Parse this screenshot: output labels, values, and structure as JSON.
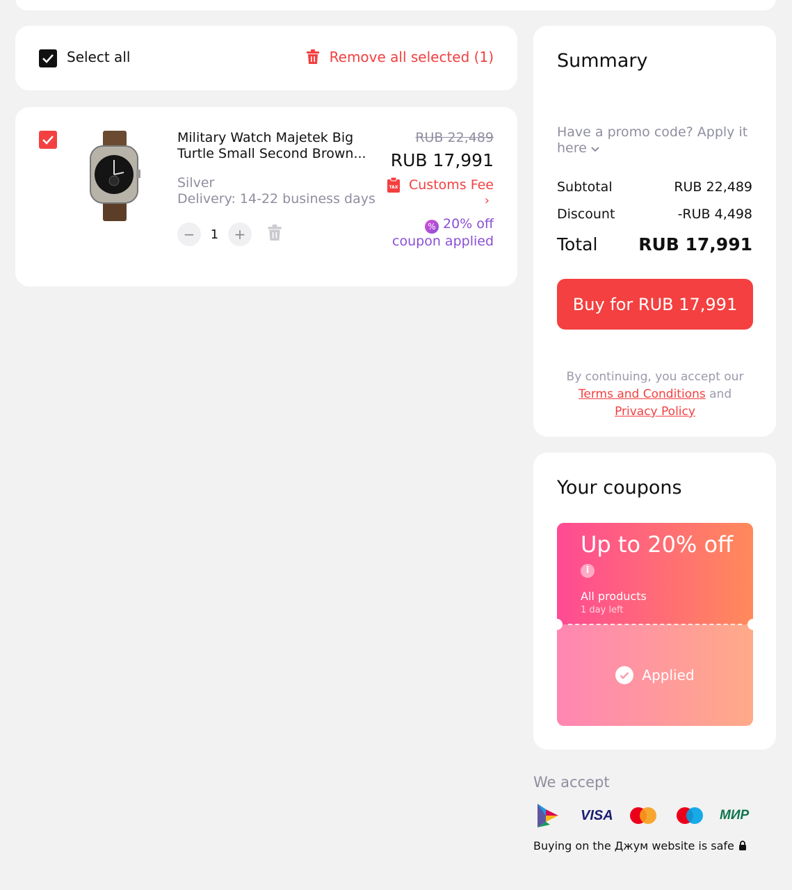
{
  "cart": {
    "select_all_label": "Select all",
    "remove_all_label": "Remove all selected (1)",
    "item": {
      "title": "Military Watch Majetek Big Turtle Small Second Brown...",
      "variant": "Silver",
      "delivery": "Delivery: 14-22 business days",
      "quantity": "1",
      "old_price": "RUB 22,489",
      "price": "RUB 17,991",
      "customs_label": "Customs Fee",
      "customs_arrow": "›",
      "coupon_line1": "20% off",
      "coupon_line2": "coupon applied",
      "minus": "−",
      "plus": "+"
    }
  },
  "summary": {
    "title": "Summary",
    "promo": "Have a promo code? Apply it here",
    "subtotal_label": "Subtotal",
    "subtotal_value": "RUB 22,489",
    "discount_label": "Discount",
    "discount_value": "-RUB 4,498",
    "total_label": "Total",
    "total_value": "RUB 17,991",
    "buy_label": "Buy for RUB 17,991",
    "legal_prefix": "By continuing, you accept our",
    "terms_link": "Terms and Conditions",
    "legal_and": "and",
    "privacy_link": "Privacy Policy"
  },
  "coupons": {
    "title": "Your coupons",
    "headline": "Up to 20% off",
    "info": "i",
    "scope": "All products",
    "time_left": "1 day left",
    "applied_label": "Applied"
  },
  "payments": {
    "title": "We accept",
    "visa_label": "VISA",
    "mir_label": "МИР",
    "safe_text": "Buying on the Джум website is safe"
  },
  "colors": {
    "accent_red": "#f44040",
    "coupon_purple": "#8a4fd6",
    "muted_text": "#8e8ea0"
  }
}
